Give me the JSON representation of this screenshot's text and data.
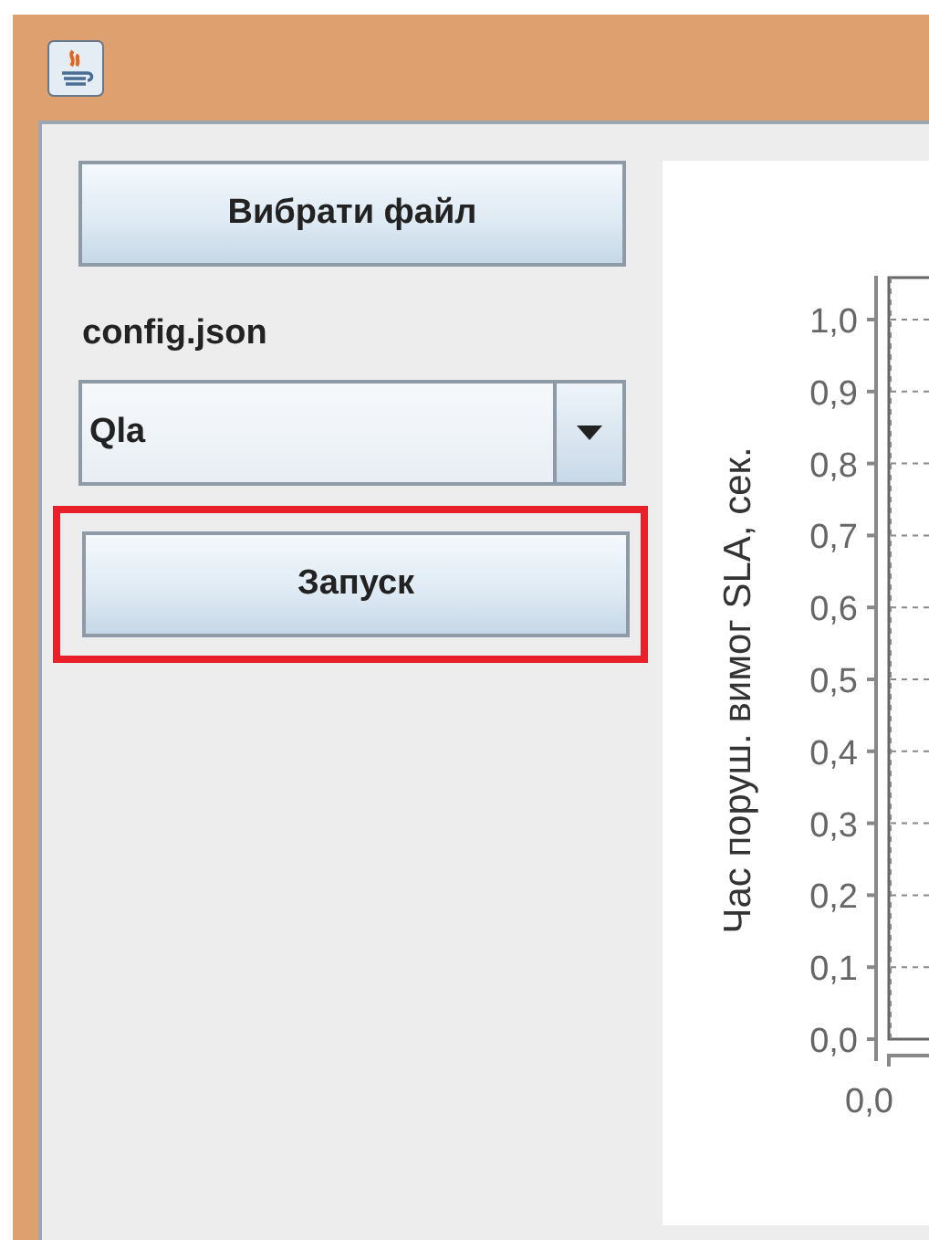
{
  "controls": {
    "choose_button": "Вибрати файл",
    "file_label": "config.json",
    "mode_select": {
      "value": "Qla"
    },
    "run_button": {
      "label": "Запуск",
      "highlighted": true
    }
  },
  "chart": {
    "y_axis_title": "Час поруш. вимог SLA, сек.",
    "y_tick_labels": [
      "1,0",
      "0,9",
      "0,8",
      "0,7",
      "0,6",
      "0,5",
      "0,4",
      "0,3",
      "0,2",
      "0,1",
      "0,0"
    ],
    "x_axis_label_partial": "0,0"
  }
}
